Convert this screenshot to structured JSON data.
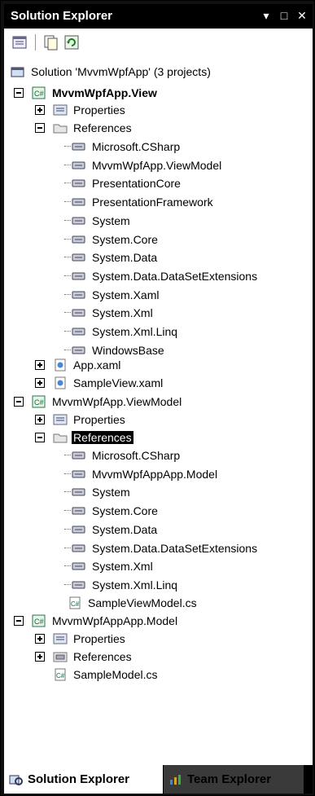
{
  "window": {
    "title": "Solution Explorer"
  },
  "toolbar": {
    "buttons": [
      "properties-icon",
      "show-all-files-icon",
      "refresh-icon"
    ]
  },
  "tree": {
    "solution": "Solution 'MvvmWpfApp' (3 projects)",
    "view_project": {
      "name": "MvvmWpfApp.View",
      "properties": "Properties",
      "references": "References",
      "refs": [
        "Microsoft.CSharp",
        "MvvmWpfApp.ViewModel",
        "PresentationCore",
        "PresentationFramework",
        "System",
        "System.Core",
        "System.Data",
        "System.Data.DataSetExtensions",
        "System.Xaml",
        "System.Xml",
        "System.Xml.Linq",
        "WindowsBase"
      ],
      "app_xaml": "App.xaml",
      "sample_view": "SampleView.xaml"
    },
    "viewmodel_project": {
      "name": "MvvmWpfApp.ViewModel",
      "properties": "Properties",
      "references": "References",
      "refs": [
        "Microsoft.CSharp",
        "MvvmWpfAppApp.Model",
        "System",
        "System.Core",
        "System.Data",
        "System.Data.DataSetExtensions",
        "System.Xml",
        "System.Xml.Linq"
      ],
      "sample_viewmodel": "SampleViewModel.cs"
    },
    "model_project": {
      "name": "MvvmWpfAppApp.Model",
      "properties": "Properties",
      "references": "References",
      "sample_model": "SampleModel.cs"
    }
  },
  "tabs": {
    "solution_explorer": "Solution Explorer",
    "team_explorer": "Team Explorer"
  }
}
